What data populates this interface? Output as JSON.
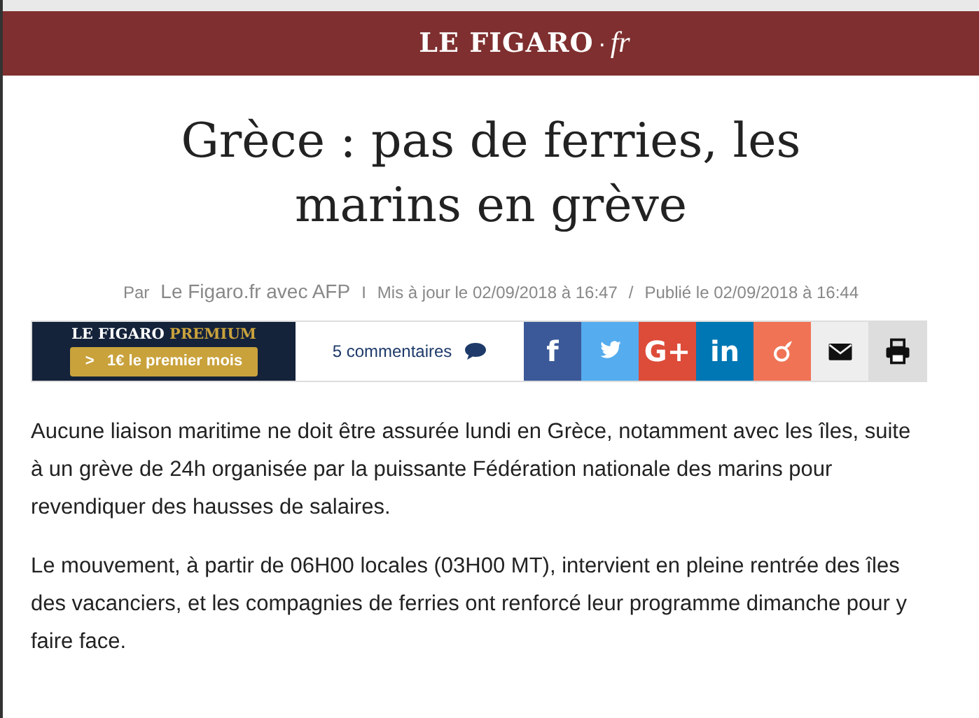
{
  "header": {
    "logo": "LE FIGARO",
    "logo_dot": "·",
    "logo_suffix": "fr"
  },
  "title": "Grèce : pas de ferries, les marins en grève",
  "meta": {
    "by_label": "Par",
    "author": "Le Figaro.fr avec AFP",
    "separator": "I",
    "updated": "Mis à jour le 02/09/2018 à 16:47",
    "slash": "/",
    "published": "Publié le 02/09/2018 à 16:44"
  },
  "premium": {
    "brand": "LE FIGARO",
    "brand_suffix": "PREMIUM",
    "offer_arrow": ">",
    "offer": "1€ le premier mois"
  },
  "comments": "5 commentaires",
  "share_buttons": [
    {
      "kind": "text",
      "label": "f",
      "color": "#3b5998"
    },
    {
      "kind": "bird",
      "color": "#55acee"
    },
    {
      "kind": "text",
      "label": "G+",
      "color": "#dd4b39"
    },
    {
      "kind": "text",
      "label": "in",
      "color": "#0077b5"
    },
    {
      "kind": "viadeo",
      "color": "#f07355"
    },
    {
      "kind": "mail",
      "color": "#eeeeee"
    },
    {
      "kind": "print",
      "color": "#dddddd"
    }
  ],
  "paragraphs": [
    "Aucune liaison maritime ne doit être assurée lundi en Grèce, notamment avec les îles, suite à un grève de 24h organisée par la puissante Fédération nationale des marins pour revendiquer des hausses de salaires.",
    "Le mouvement, à partir de 06H00 locales (03H00 MT), intervient en pleine rentrée des îles des vacanciers, et les compagnies de ferries ont renforcé leur programme dimanche pour y faire face."
  ]
}
